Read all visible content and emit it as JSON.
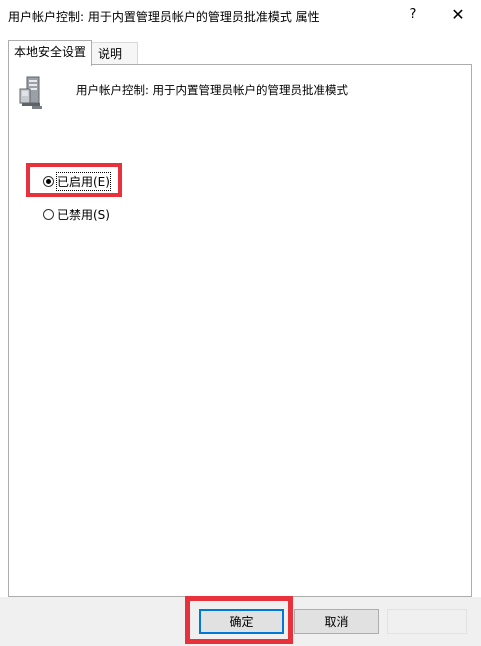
{
  "window": {
    "title": "用户帐户控制: 用于内置管理员帐户的管理员批准模式 属性",
    "help_label": "?",
    "close_label": "✕"
  },
  "tabs": [
    {
      "label": "本地安全设置",
      "active": true
    },
    {
      "label": "说明",
      "active": false
    }
  ],
  "policy": {
    "icon": "server-computer-icon",
    "name": "用户帐户控制: 用于内置管理员帐户的管理员批准模式"
  },
  "options": [
    {
      "label": "已启用(E)",
      "selected": true
    },
    {
      "label": "已禁用(S)",
      "selected": false
    }
  ],
  "buttons": {
    "ok": "确定",
    "cancel": "取消"
  },
  "colors": {
    "highlight": "#e8313b",
    "focus_border": "#0078d7"
  }
}
